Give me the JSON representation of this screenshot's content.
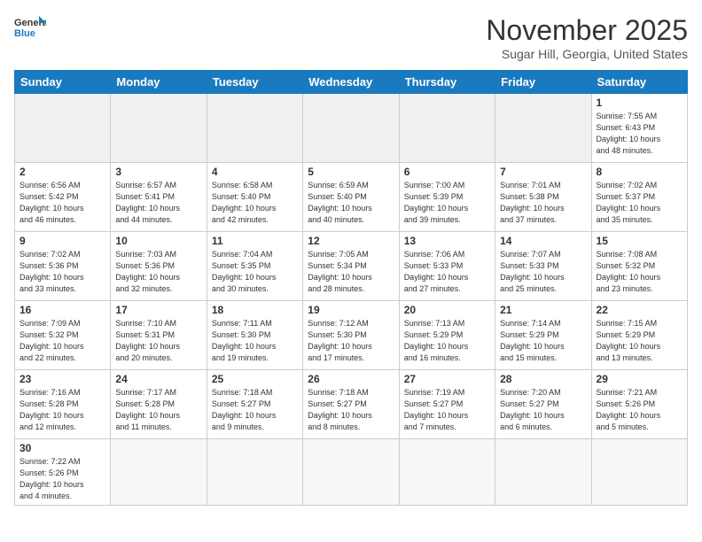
{
  "header": {
    "logo_general": "General",
    "logo_blue": "Blue",
    "title": "November 2025",
    "subtitle": "Sugar Hill, Georgia, United States"
  },
  "weekdays": [
    "Sunday",
    "Monday",
    "Tuesday",
    "Wednesday",
    "Thursday",
    "Friday",
    "Saturday"
  ],
  "weeks": [
    [
      {
        "num": "",
        "info": "",
        "empty": true
      },
      {
        "num": "",
        "info": "",
        "empty": true
      },
      {
        "num": "",
        "info": "",
        "empty": true
      },
      {
        "num": "",
        "info": "",
        "empty": true
      },
      {
        "num": "",
        "info": "",
        "empty": true
      },
      {
        "num": "",
        "info": "",
        "empty": true
      },
      {
        "num": "1",
        "info": "Sunrise: 7:55 AM\nSunset: 6:43 PM\nDaylight: 10 hours\nand 48 minutes."
      }
    ],
    [
      {
        "num": "2",
        "info": "Sunrise: 6:56 AM\nSunset: 5:42 PM\nDaylight: 10 hours\nand 46 minutes."
      },
      {
        "num": "3",
        "info": "Sunrise: 6:57 AM\nSunset: 5:41 PM\nDaylight: 10 hours\nand 44 minutes."
      },
      {
        "num": "4",
        "info": "Sunrise: 6:58 AM\nSunset: 5:40 PM\nDaylight: 10 hours\nand 42 minutes."
      },
      {
        "num": "5",
        "info": "Sunrise: 6:59 AM\nSunset: 5:40 PM\nDaylight: 10 hours\nand 40 minutes."
      },
      {
        "num": "6",
        "info": "Sunrise: 7:00 AM\nSunset: 5:39 PM\nDaylight: 10 hours\nand 39 minutes."
      },
      {
        "num": "7",
        "info": "Sunrise: 7:01 AM\nSunset: 5:38 PM\nDaylight: 10 hours\nand 37 minutes."
      },
      {
        "num": "8",
        "info": "Sunrise: 7:02 AM\nSunset: 5:37 PM\nDaylight: 10 hours\nand 35 minutes."
      }
    ],
    [
      {
        "num": "9",
        "info": "Sunrise: 7:02 AM\nSunset: 5:36 PM\nDaylight: 10 hours\nand 33 minutes."
      },
      {
        "num": "10",
        "info": "Sunrise: 7:03 AM\nSunset: 5:36 PM\nDaylight: 10 hours\nand 32 minutes."
      },
      {
        "num": "11",
        "info": "Sunrise: 7:04 AM\nSunset: 5:35 PM\nDaylight: 10 hours\nand 30 minutes."
      },
      {
        "num": "12",
        "info": "Sunrise: 7:05 AM\nSunset: 5:34 PM\nDaylight: 10 hours\nand 28 minutes."
      },
      {
        "num": "13",
        "info": "Sunrise: 7:06 AM\nSunset: 5:33 PM\nDaylight: 10 hours\nand 27 minutes."
      },
      {
        "num": "14",
        "info": "Sunrise: 7:07 AM\nSunset: 5:33 PM\nDaylight: 10 hours\nand 25 minutes."
      },
      {
        "num": "15",
        "info": "Sunrise: 7:08 AM\nSunset: 5:32 PM\nDaylight: 10 hours\nand 23 minutes."
      }
    ],
    [
      {
        "num": "16",
        "info": "Sunrise: 7:09 AM\nSunset: 5:32 PM\nDaylight: 10 hours\nand 22 minutes."
      },
      {
        "num": "17",
        "info": "Sunrise: 7:10 AM\nSunset: 5:31 PM\nDaylight: 10 hours\nand 20 minutes."
      },
      {
        "num": "18",
        "info": "Sunrise: 7:11 AM\nSunset: 5:30 PM\nDaylight: 10 hours\nand 19 minutes."
      },
      {
        "num": "19",
        "info": "Sunrise: 7:12 AM\nSunset: 5:30 PM\nDaylight: 10 hours\nand 17 minutes."
      },
      {
        "num": "20",
        "info": "Sunrise: 7:13 AM\nSunset: 5:29 PM\nDaylight: 10 hours\nand 16 minutes."
      },
      {
        "num": "21",
        "info": "Sunrise: 7:14 AM\nSunset: 5:29 PM\nDaylight: 10 hours\nand 15 minutes."
      },
      {
        "num": "22",
        "info": "Sunrise: 7:15 AM\nSunset: 5:29 PM\nDaylight: 10 hours\nand 13 minutes."
      }
    ],
    [
      {
        "num": "23",
        "info": "Sunrise: 7:16 AM\nSunset: 5:28 PM\nDaylight: 10 hours\nand 12 minutes."
      },
      {
        "num": "24",
        "info": "Sunrise: 7:17 AM\nSunset: 5:28 PM\nDaylight: 10 hours\nand 11 minutes."
      },
      {
        "num": "25",
        "info": "Sunrise: 7:18 AM\nSunset: 5:27 PM\nDaylight: 10 hours\nand 9 minutes."
      },
      {
        "num": "26",
        "info": "Sunrise: 7:18 AM\nSunset: 5:27 PM\nDaylight: 10 hours\nand 8 minutes."
      },
      {
        "num": "27",
        "info": "Sunrise: 7:19 AM\nSunset: 5:27 PM\nDaylight: 10 hours\nand 7 minutes."
      },
      {
        "num": "28",
        "info": "Sunrise: 7:20 AM\nSunset: 5:27 PM\nDaylight: 10 hours\nand 6 minutes."
      },
      {
        "num": "29",
        "info": "Sunrise: 7:21 AM\nSunset: 5:26 PM\nDaylight: 10 hours\nand 5 minutes."
      }
    ],
    [
      {
        "num": "30",
        "info": "Sunrise: 7:22 AM\nSunset: 5:26 PM\nDaylight: 10 hours\nand 4 minutes."
      },
      {
        "num": "",
        "info": "",
        "empty": true
      },
      {
        "num": "",
        "info": "",
        "empty": true
      },
      {
        "num": "",
        "info": "",
        "empty": true
      },
      {
        "num": "",
        "info": "",
        "empty": true
      },
      {
        "num": "",
        "info": "",
        "empty": true
      },
      {
        "num": "",
        "info": "",
        "empty": true
      }
    ]
  ]
}
